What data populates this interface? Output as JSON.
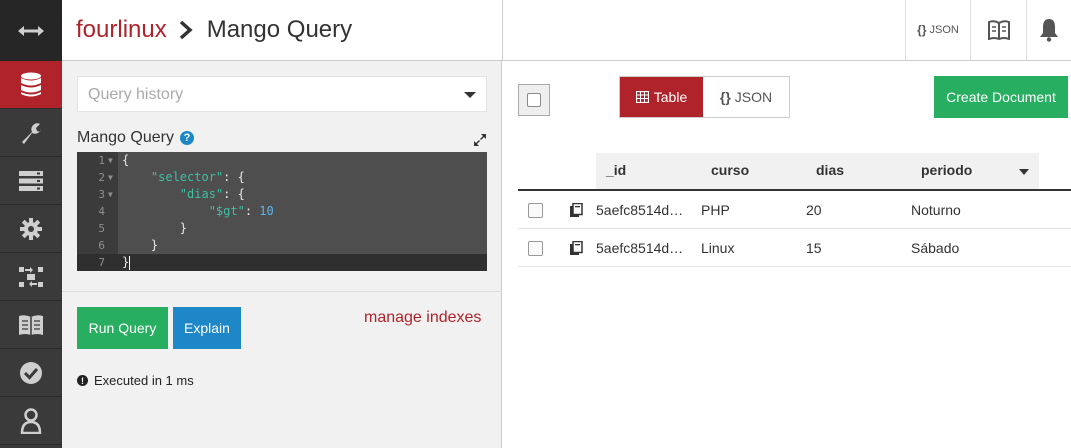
{
  "header": {
    "database": "fourlinux",
    "page_title": "Mango Query",
    "json_button": "JSON",
    "json_braces": "{}"
  },
  "nav": {
    "items": [
      {
        "icon": "database-icon",
        "active": true
      },
      {
        "icon": "wrench-icon",
        "active": false
      },
      {
        "icon": "server-icon",
        "active": false
      },
      {
        "icon": "gear-icon",
        "active": false
      },
      {
        "icon": "replication-icon",
        "active": false
      },
      {
        "icon": "book-icon",
        "active": false
      },
      {
        "icon": "check-circle-icon",
        "active": false
      },
      {
        "icon": "user-icon",
        "active": false
      }
    ]
  },
  "query": {
    "history_placeholder": "Query history",
    "label": "Mango Query",
    "help_glyph": "?",
    "code_lines": [
      {
        "num": "1",
        "fold": true
      },
      {
        "num": "2",
        "fold": true
      },
      {
        "num": "3",
        "fold": true
      },
      {
        "num": "4",
        "fold": false
      },
      {
        "num": "5",
        "fold": false
      },
      {
        "num": "6",
        "fold": false
      },
      {
        "num": "7",
        "fold": false
      }
    ],
    "code": {
      "open_brace": "{",
      "selector_key": "\"selector\"",
      "colon_brace": ": {",
      "dias_key": "\"dias\"",
      "gt_key": "\"$gt\"",
      "colon": ": ",
      "gt_value": "10",
      "close_brace": "}"
    },
    "run_button": "Run Query",
    "explain_button": "Explain",
    "manage_indexes": "manage indexes",
    "status": "Executed in 1 ms",
    "status_glyph": "!"
  },
  "results": {
    "view_table_label": "Table",
    "view_json_label": "JSON",
    "view_json_braces": "{}",
    "active_view": "table",
    "create_button": "Create Document",
    "columns": [
      "_id",
      "curso",
      "dias",
      "periodo"
    ],
    "rows": [
      {
        "id": "5aefc8514d…",
        "curso": "PHP",
        "dias": "20",
        "periodo": "Noturno"
      },
      {
        "id": "5aefc8514d…",
        "curso": "Linux",
        "dias": "15",
        "periodo": "Sábado"
      }
    ]
  },
  "colors": {
    "brand_red": "#b0232a",
    "green": "#27ae60",
    "blue": "#1e87c8"
  }
}
